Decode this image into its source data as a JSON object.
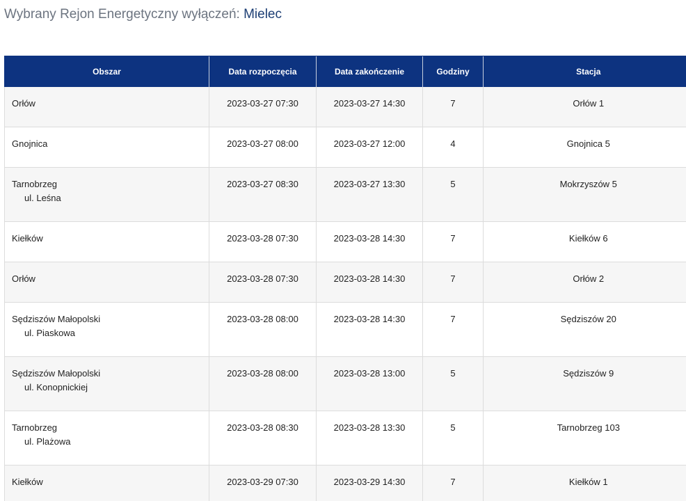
{
  "header": {
    "prefix": "Wybrany Rejon Energetyczny wyłączeń: ",
    "region": "Mielec"
  },
  "table": {
    "columns": [
      "Obszar",
      "Data rozpoczęcia",
      "Data zakończenie",
      "Godziny",
      "Stacja"
    ],
    "rows": [
      {
        "area": "Orłów",
        "street": "",
        "start": "2023-03-27 07:30",
        "end": "2023-03-27 14:30",
        "hours": "7",
        "station": "Orłów 1"
      },
      {
        "area": "Gnojnica",
        "street": "",
        "start": "2023-03-27 08:00",
        "end": "2023-03-27 12:00",
        "hours": "4",
        "station": "Gnojnica 5"
      },
      {
        "area": "Tarnobrzeg",
        "street": "ul. Leśna",
        "start": "2023-03-27 08:30",
        "end": "2023-03-27 13:30",
        "hours": "5",
        "station": "Mokrzyszów 5"
      },
      {
        "area": "Kiełków",
        "street": "",
        "start": "2023-03-28 07:30",
        "end": "2023-03-28 14:30",
        "hours": "7",
        "station": "Kiełków 6"
      },
      {
        "area": "Orłów",
        "street": "",
        "start": "2023-03-28 07:30",
        "end": "2023-03-28 14:30",
        "hours": "7",
        "station": "Orłów 2"
      },
      {
        "area": "Sędziszów Małopolski",
        "street": "ul. Piaskowa",
        "start": "2023-03-28 08:00",
        "end": "2023-03-28 14:30",
        "hours": "7",
        "station": "Sędziszów 20"
      },
      {
        "area": "Sędziszów Małopolski",
        "street": "ul. Konopnickiej",
        "start": "2023-03-28 08:00",
        "end": "2023-03-28 13:00",
        "hours": "5",
        "station": "Sędziszów 9"
      },
      {
        "area": "Tarnobrzeg",
        "street": "ul. Plażowa",
        "start": "2023-03-28 08:30",
        "end": "2023-03-28 13:30",
        "hours": "5",
        "station": "Tarnobrzeg 103"
      },
      {
        "area": "Kiełków",
        "street": "",
        "start": "2023-03-29 07:30",
        "end": "2023-03-29 14:30",
        "hours": "7",
        "station": "Kiełków 1"
      }
    ]
  }
}
